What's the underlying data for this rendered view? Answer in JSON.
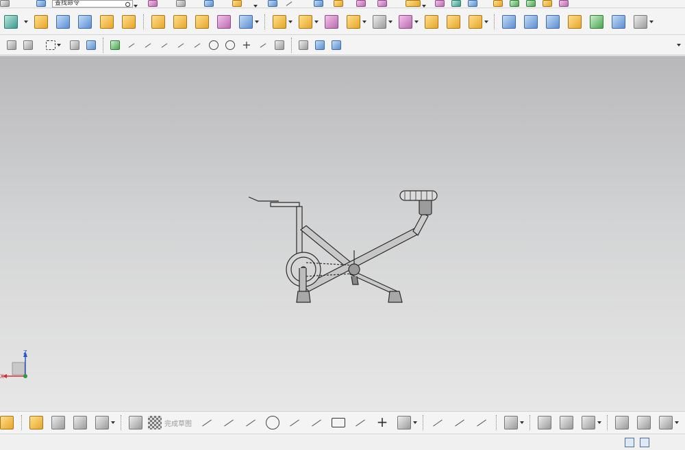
{
  "command_finder": {
    "value": "查找命令",
    "icon": "magnifier-icon"
  },
  "toolbars": {
    "standard": {
      "icons": [
        "home-icon",
        "orient-view-icon",
        "diamond-icon",
        "image-capture-icon",
        "measure-tool-icon",
        "solid-cube-icon",
        "layer-icon",
        "curve-arrow-icon",
        "sheet-icon",
        "analysis-icon",
        "wrench-icon",
        "diamond-view-icon",
        "point-constructor-icon",
        "ruler-icon",
        "assembly-icon",
        "layer-stack-icon",
        "table-icon",
        "note-icon",
        "check-icon",
        "check-green-icon",
        "check-edit-icon",
        "abc-text-icon"
      ]
    },
    "features": {
      "icons": [
        "sketch-icon",
        "extrude-icon",
        "revolve-icon",
        "hole-icon",
        "boss-icon",
        "shell-icon",
        "box-icon",
        "fold-icon",
        "thicken-icon",
        "pocket-icon",
        "wireframe-cube-icon",
        "unite-icon",
        "subtract-icon",
        "intersect-icon",
        "pattern-icon",
        "mirror-icon",
        "offset-face-icon",
        "trim-body-icon",
        "blend-icon",
        "chamfer-icon",
        "draft-icon",
        "surface-icon",
        "mesh-surface-icon",
        "sweep-icon",
        "section-icon",
        "freeform-icon",
        "check-geometry-icon",
        "bridge-icon",
        "label-icon"
      ]
    },
    "snap": {
      "icons": [
        "snap-point-icon",
        "snap-end-icon",
        "selection-box-icon",
        "filter-cube-icon",
        "filter-body-icon",
        "inference-icon",
        "line-icon",
        "tangent-line-icon",
        "spline-icon",
        "corner-icon",
        "midpoint-icon",
        "center-circle-icon",
        "quadrant-icon",
        "intersection-icon",
        "slash-icon",
        "eraser-icon",
        "layer-visible-icon",
        "display-sheet-icon",
        "datum-csys-icon"
      ]
    },
    "sketch": {
      "finish_label": "完成草图",
      "icons": [
        "feature-nav-icon",
        "constraint-icon",
        "dimension-icon",
        "tree-icon",
        "cube-orient-icon",
        "sketch-settings-icon",
        "profile-icon",
        "line-icon",
        "arc-icon",
        "circle-icon",
        "fillet-icon",
        "chamfer-icon",
        "rectangle-icon",
        "polygon-icon",
        "point-icon",
        "studio-spline-icon",
        "quick-trim-icon",
        "quick-extend-icon",
        "make-corner-icon",
        "offset-curve-icon",
        "mirror-curve-icon",
        "intersection-point-icon",
        "pattern-curve-icon",
        "geometric-constraints-icon",
        "auto-constrain-icon",
        "show-constraints-icon"
      ]
    }
  },
  "viewport": {
    "background_top": "#b8b8ba",
    "background_bottom": "#e7e7e7",
    "model": "exercise-bike",
    "triad": {
      "z_label": "Z",
      "x_label": "X",
      "x_color": "#d03030",
      "z_color": "#2a55c8",
      "y_color": "#2e9a3a"
    }
  },
  "status_icons": [
    "switch-window-icon",
    "full-screen-icon"
  ]
}
